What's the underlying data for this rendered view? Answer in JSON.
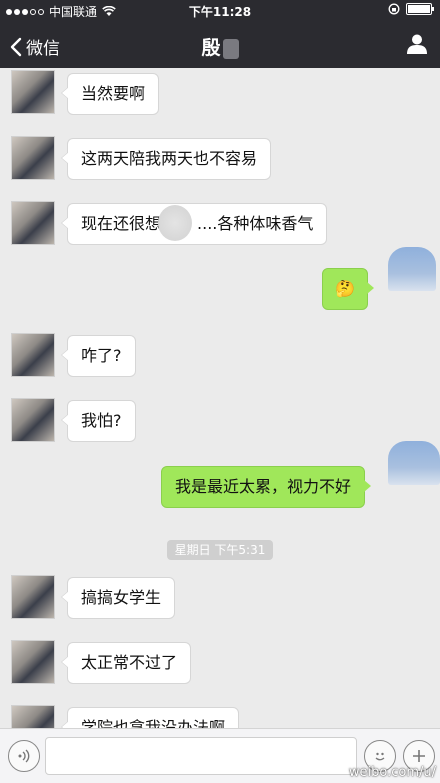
{
  "status_bar": {
    "carrier": "中国联通",
    "time": "下午11:28"
  },
  "nav": {
    "back_label": "微信",
    "title": "殷"
  },
  "messages": [
    {
      "side": "left",
      "text": "当然要啊"
    },
    {
      "side": "left",
      "text": "这两天陪我两天也不容易"
    },
    {
      "side": "left",
      "text": "现在还很想",
      "tail": "....各种体味香气"
    },
    {
      "side": "right",
      "text": "🤔"
    },
    {
      "side": "left",
      "text": "咋了?"
    },
    {
      "side": "left",
      "text": "我怕?"
    },
    {
      "side": "right",
      "text": "我是最近太累，视力不好"
    },
    {
      "side": "left",
      "text": "搞搞女学生"
    },
    {
      "side": "left",
      "text": "太正常不过了"
    },
    {
      "side": "left",
      "text": "学院也拿我没办法啊"
    }
  ],
  "timestamp": "星期日 下午5:31",
  "watermark": "weibo.com/u/"
}
